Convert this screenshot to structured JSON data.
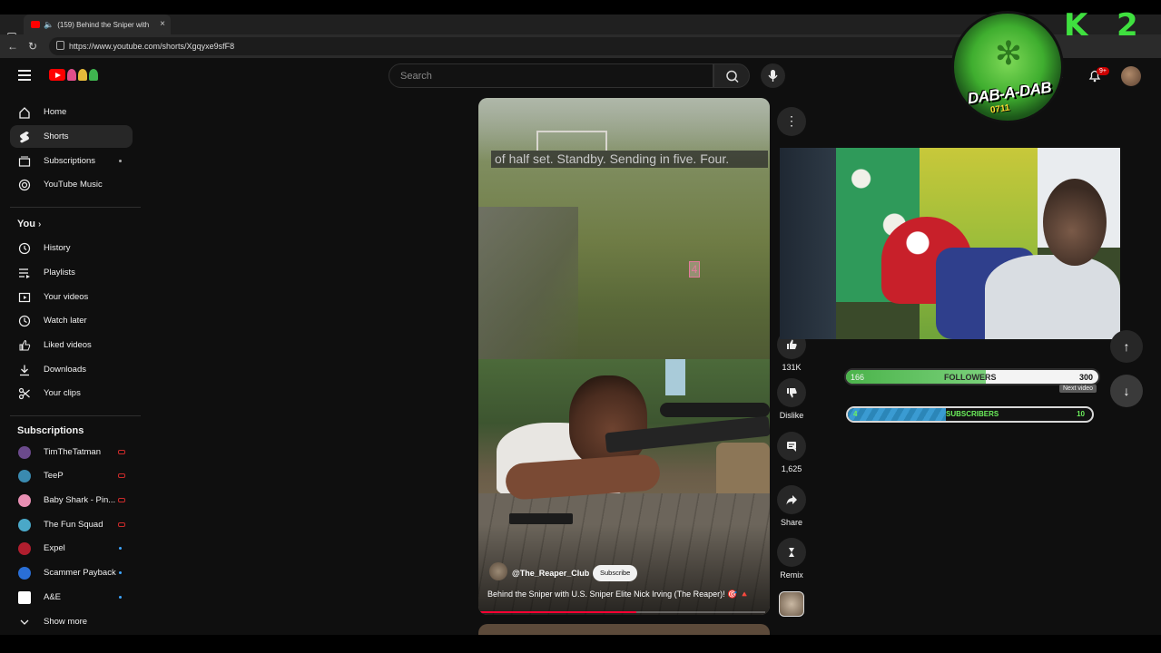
{
  "browser": {
    "tab_title": "(159) Behind the Sniper with",
    "tab_close": "×",
    "new_tab": "+",
    "url": "https://www.youtube.com/shorts/Xgqyxe9sfF8"
  },
  "header": {
    "search_placeholder": "Search",
    "notif_badge": "9+",
    "partial_text": "a"
  },
  "sidebar": {
    "main": [
      {
        "label": "Home",
        "icon": "home-icon"
      },
      {
        "label": "Shorts",
        "icon": "shorts-icon",
        "active": true
      },
      {
        "label": "Subscriptions",
        "icon": "subscriptions-icon"
      },
      {
        "label": "YouTube Music",
        "icon": "music-icon"
      }
    ],
    "you_header": "You",
    "you": [
      {
        "label": "History",
        "icon": "history-icon"
      },
      {
        "label": "Playlists",
        "icon": "playlists-icon"
      },
      {
        "label": "Your videos",
        "icon": "your-videos-icon"
      },
      {
        "label": "Watch later",
        "icon": "watch-later-icon"
      },
      {
        "label": "Liked videos",
        "icon": "thumb-up-icon"
      },
      {
        "label": "Downloads",
        "icon": "download-icon"
      },
      {
        "label": "Your clips",
        "icon": "scissors-icon"
      }
    ],
    "subs_header": "Subscriptions",
    "subs": [
      {
        "label": "TimTheTatman",
        "status": "live",
        "color": "#6b4a8c"
      },
      {
        "label": "TeeP",
        "status": "live",
        "color": "#3a8ab0"
      },
      {
        "label": "Baby Shark - Pin...",
        "status": "live",
        "color": "#e88fb3"
      },
      {
        "label": "The Fun Squad",
        "status": "live",
        "color": "#4aa8c8"
      },
      {
        "label": "Expel",
        "status": "new",
        "color": "#b01e2e"
      },
      {
        "label": "Scammer Payback",
        "status": "new",
        "color": "#2a6fd6"
      },
      {
        "label": "A&E",
        "status": "new",
        "color": "#ffffff"
      }
    ],
    "show_more": "Show more"
  },
  "short": {
    "caption": "of half set. Standby. Sending in five. Four.",
    "target_number": "4",
    "channel": "@The_Reaper_Club",
    "subscribe": "Subscribe",
    "title": "Behind the Sniper with U.S. Sniper Elite Nick Irving (The Reaper)! 🎯 🔺",
    "progress": 0.55
  },
  "actions": {
    "like_count": "131K",
    "dislike": "Dislike",
    "comments": "1,625",
    "share": "Share",
    "remix": "Remix"
  },
  "overlay": {
    "followers_current": "166",
    "followers_label": "FOLLOWERS",
    "followers_goal": "300",
    "followers_progress": 0.553,
    "subscribers_current": "4",
    "subscribers_label": "SUBSCRIBERS",
    "subscribers_goal": "10",
    "subscribers_progress": 0.4,
    "next_video_tooltip": "Next video",
    "dab_text": "DAB-A-DAB",
    "dab_num": "0711",
    "k2_k": "K",
    "k2_2": "2"
  }
}
